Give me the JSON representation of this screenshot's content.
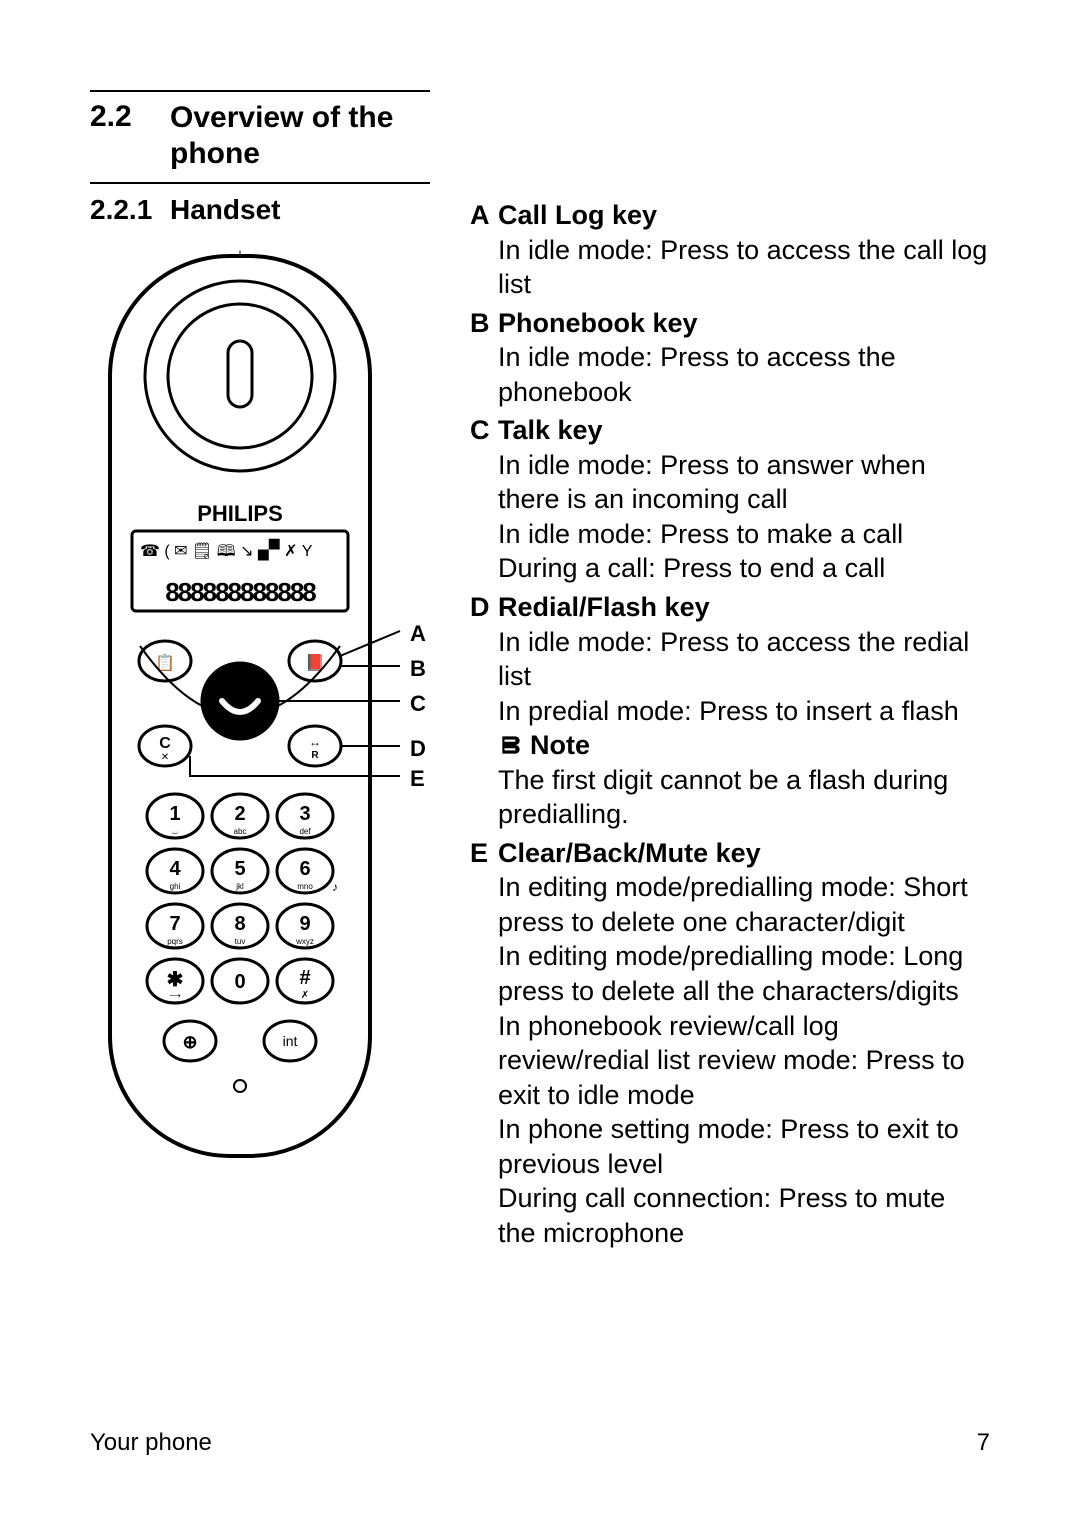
{
  "section": {
    "number": "2.2",
    "title": "Overview of the phone"
  },
  "subsection": {
    "number": "2.2.1",
    "title": "Handset"
  },
  "brand": "PHILIPS",
  "display_digits": "888888888888",
  "keypad": {
    "1": "1",
    "2": "2",
    "2sub": "abc",
    "3": "3",
    "3sub": "def",
    "4": "4",
    "4sub": "ghi",
    "5": "5",
    "5sub": "jkl",
    "6": "6",
    "6sub": "mno",
    "7": "7",
    "7sub": "pqrs",
    "8": "8",
    "8sub": "tuv",
    "9": "9",
    "9sub": "wxyz",
    "star": "✱",
    "0": "0",
    "hash": "#",
    "int": "int"
  },
  "callout_labels": {
    "A": "A",
    "B": "B",
    "C": "C",
    "D": "D",
    "E": "E"
  },
  "keys": {
    "A": {
      "title": "Call Log key",
      "lines": [
        "In idle mode: Press to access the call log list"
      ]
    },
    "B": {
      "title": "Phonebook key",
      "lines": [
        "In idle mode: Press to access the phonebook"
      ]
    },
    "C": {
      "title": "Talk key",
      "lines": [
        "In idle mode: Press to answer when there is an incoming call",
        "In idle mode: Press to make a call",
        "During a call: Press to end a call"
      ]
    },
    "D": {
      "title": "Redial/Flash key",
      "lines": [
        "In idle mode: Press to access the redial list",
        "In predial mode: Press to insert a flash"
      ],
      "note_label": "Note",
      "note_body": "The first digit cannot be a flash during predialling."
    },
    "E": {
      "title": "Clear/Back/Mute key",
      "lines": [
        "In editing mode/predialling mode: Short press to delete one character/digit",
        "In editing mode/predialling mode: Long press to delete all the characters/digits",
        "In phonebook review/call log review/redial list review mode: Press to exit to idle mode",
        "In phone setting mode: Press to exit to previous level",
        "During call connection: Press to mute the microphone"
      ]
    }
  },
  "footer": {
    "left": "Your phone",
    "right": "7"
  }
}
